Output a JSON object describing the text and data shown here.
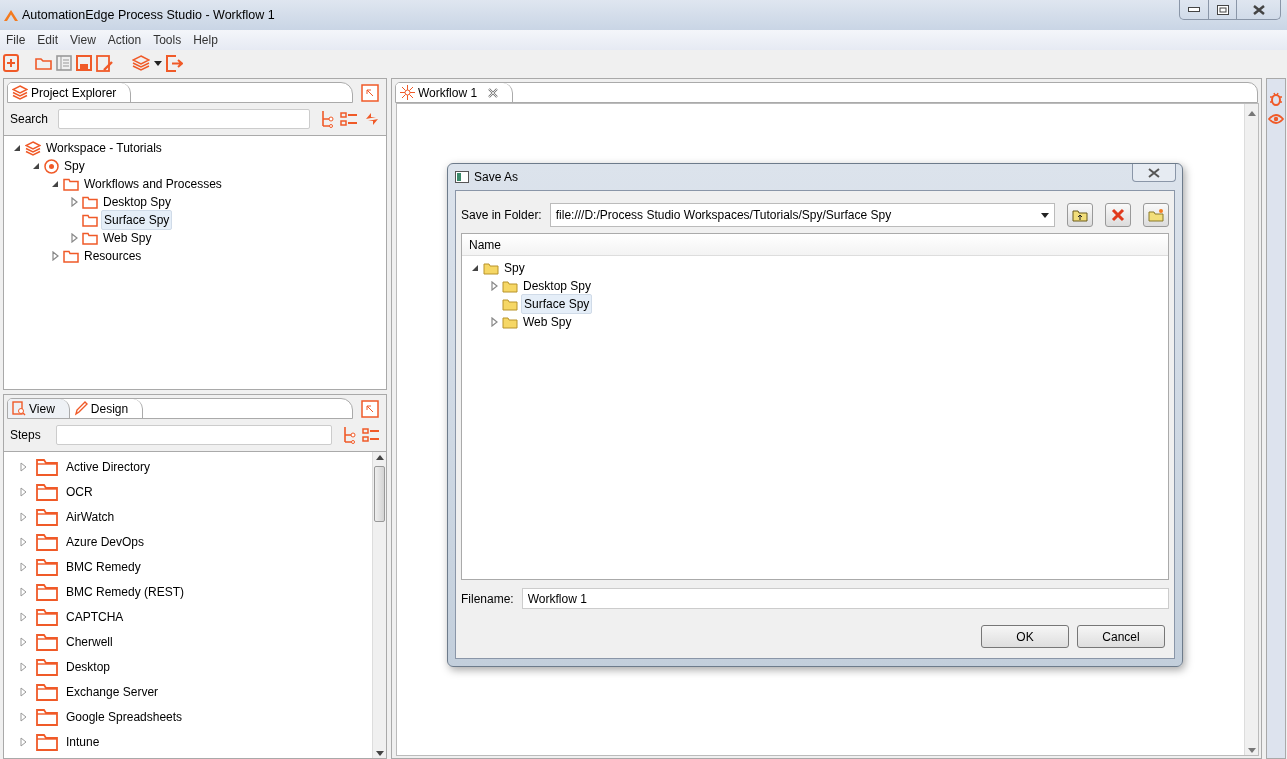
{
  "window": {
    "title": "AutomationEdge Process Studio - Workflow 1"
  },
  "menu": [
    "File",
    "Edit",
    "View",
    "Action",
    "Tools",
    "Help"
  ],
  "project_explorer": {
    "tab": "Project Explorer",
    "search_label": "Search",
    "tree": [
      {
        "label": "Workspace - Tutorials",
        "kind": "workspace",
        "has_children": true,
        "expanded": true,
        "selected": false,
        "children": [
          {
            "label": "Spy",
            "kind": "project",
            "has_children": true,
            "expanded": true,
            "selected": false,
            "children": [
              {
                "label": "Workflows and Processes",
                "kind": "folder",
                "has_children": true,
                "expanded": true,
                "selected": false,
                "children": [
                  {
                    "label": "Desktop Spy",
                    "kind": "folder",
                    "has_children": true,
                    "expanded": false,
                    "selected": false
                  },
                  {
                    "label": "Surface Spy",
                    "kind": "folder",
                    "has_children": false,
                    "selected": true
                  },
                  {
                    "label": "Web Spy",
                    "kind": "folder",
                    "has_children": true,
                    "expanded": false,
                    "selected": false
                  }
                ]
              },
              {
                "label": "Resources",
                "kind": "folder",
                "has_children": true,
                "expanded": false,
                "selected": false
              }
            ]
          }
        ]
      }
    ]
  },
  "design_panel": {
    "tabs": [
      {
        "label": "View",
        "kind": "view",
        "selected": false
      },
      {
        "label": "Design",
        "kind": "design",
        "selected": true
      }
    ],
    "steps_label": "Steps",
    "steps": [
      "Active Directory",
      "OCR",
      "AirWatch",
      "Azure DevOps",
      "BMC Remedy",
      "BMC Remedy (REST)",
      "CAPTCHA",
      "Cherwell",
      "Desktop",
      "Exchange Server",
      "Google Spreadsheets",
      "Intune"
    ]
  },
  "editor": {
    "tab": "Workflow 1"
  },
  "dialog": {
    "title": "Save As",
    "folder_label": "Save in Folder:",
    "folder": "file:///D:/Process Studio Workspaces/Tutorials/Spy/Surface Spy",
    "column": "Name",
    "tree": [
      {
        "label": "Spy",
        "has_children": true,
        "expanded": true,
        "selected": false,
        "children": [
          {
            "label": "Desktop Spy",
            "has_children": true,
            "expanded": false,
            "selected": false
          },
          {
            "label": "Surface Spy",
            "has_children": false,
            "selected": true
          },
          {
            "label": "Web Spy",
            "has_children": true,
            "expanded": false,
            "selected": false
          }
        ]
      }
    ],
    "filename_label": "Filename:",
    "filename": "Workflow 1",
    "buttons": [
      "OK",
      "Cancel"
    ]
  }
}
